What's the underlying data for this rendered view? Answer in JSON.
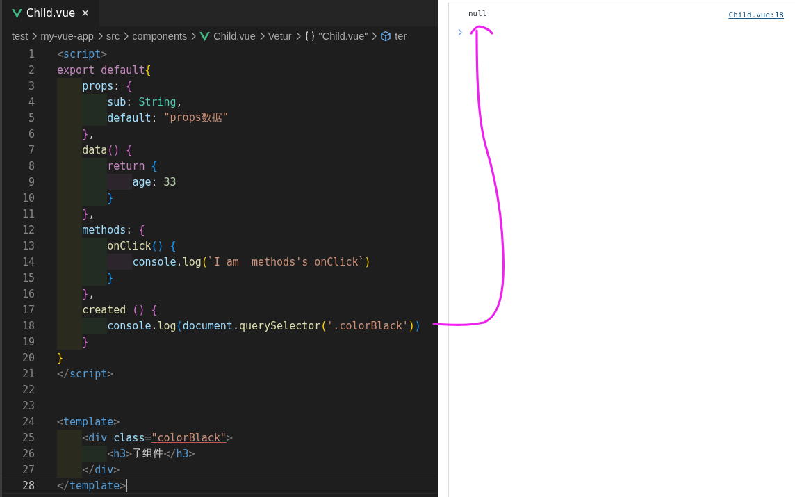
{
  "editor": {
    "tab": {
      "label": "Child.vue",
      "close": "✕",
      "selected": true
    },
    "breadcrumbs": [
      {
        "label": "test",
        "kind": "folder"
      },
      {
        "label": "my-vue-app",
        "kind": "folder"
      },
      {
        "label": "src",
        "kind": "folder"
      },
      {
        "label": "components",
        "kind": "folder"
      },
      {
        "label": "Child.vue",
        "kind": "vue"
      },
      {
        "label": "Vetur",
        "kind": "folder"
      },
      {
        "label": "\"Child.vue\"",
        "kind": "braces"
      },
      {
        "label": "ter",
        "kind": "cube"
      }
    ],
    "lines": [
      {
        "number": "1",
        "current": false,
        "tokens": [
          {
            "kind": "bracket",
            "text": "<"
          },
          {
            "kind": "tag",
            "text": "script"
          },
          {
            "kind": "bracket",
            "text": ">"
          }
        ]
      },
      {
        "number": "2",
        "current": false,
        "tokens": [
          {
            "kind": "keyword",
            "text": "export default"
          },
          {
            "kind": "brace1",
            "text": "{"
          }
        ]
      },
      {
        "number": "3",
        "current": false,
        "tokens": [
          {
            "kind": "property",
            "text": "    props"
          },
          {
            "kind": "plain",
            "text": ": "
          },
          {
            "kind": "brace2",
            "text": "{"
          }
        ]
      },
      {
        "number": "4",
        "current": false,
        "tokens": [
          {
            "kind": "property",
            "text": "        sub"
          },
          {
            "kind": "plain",
            "text": ": "
          },
          {
            "kind": "type",
            "text": "String"
          },
          {
            "kind": "plain",
            "text": ","
          }
        ]
      },
      {
        "number": "5",
        "current": false,
        "tokens": [
          {
            "kind": "property",
            "text": "        default"
          },
          {
            "kind": "plain",
            "text": ": "
          },
          {
            "kind": "string",
            "text": "\"props数据\""
          }
        ]
      },
      {
        "number": "6",
        "current": false,
        "tokens": [
          {
            "kind": "brace2",
            "text": "    }"
          },
          {
            "kind": "plain",
            "text": ","
          }
        ]
      },
      {
        "number": "7",
        "current": false,
        "tokens": [
          {
            "kind": "function",
            "text": "    data"
          },
          {
            "kind": "brace2",
            "text": "() {"
          }
        ]
      },
      {
        "number": "8",
        "current": false,
        "tokens": [
          {
            "kind": "keyword",
            "text": "        return"
          },
          {
            "kind": "brace3",
            "text": " {"
          }
        ]
      },
      {
        "number": "9",
        "current": false,
        "tokens": [
          {
            "kind": "property",
            "text": "            age"
          },
          {
            "kind": "plain",
            "text": ": "
          },
          {
            "kind": "number",
            "text": "33"
          }
        ]
      },
      {
        "number": "10",
        "current": false,
        "tokens": [
          {
            "kind": "brace3",
            "text": "        }"
          }
        ]
      },
      {
        "number": "11",
        "current": false,
        "tokens": [
          {
            "kind": "brace2",
            "text": "    }"
          },
          {
            "kind": "plain",
            "text": ","
          }
        ]
      },
      {
        "number": "12",
        "current": false,
        "tokens": [
          {
            "kind": "property",
            "text": "    methods"
          },
          {
            "kind": "plain",
            "text": ": "
          },
          {
            "kind": "brace2",
            "text": "{"
          }
        ]
      },
      {
        "number": "13",
        "current": false,
        "tokens": [
          {
            "kind": "function",
            "text": "        onClick"
          },
          {
            "kind": "brace3",
            "text": "() {"
          }
        ]
      },
      {
        "number": "14",
        "current": false,
        "tokens": [
          {
            "kind": "variable",
            "text": "            console"
          },
          {
            "kind": "plain",
            "text": "."
          },
          {
            "kind": "function",
            "text": "log"
          },
          {
            "kind": "brace1",
            "text": "("
          },
          {
            "kind": "string",
            "text": "`I am  methods's onClick`"
          },
          {
            "kind": "brace1",
            "text": ")"
          }
        ]
      },
      {
        "number": "15",
        "current": false,
        "tokens": [
          {
            "kind": "brace3",
            "text": "        }"
          }
        ]
      },
      {
        "number": "16",
        "current": false,
        "tokens": [
          {
            "kind": "brace2",
            "text": "    }"
          },
          {
            "kind": "plain",
            "text": ","
          }
        ]
      },
      {
        "number": "17",
        "current": false,
        "tokens": [
          {
            "kind": "function",
            "text": "    created"
          },
          {
            "kind": "brace2",
            "text": " () {"
          }
        ]
      },
      {
        "number": "18",
        "current": false,
        "tokens": [
          {
            "kind": "variable",
            "text": "        console"
          },
          {
            "kind": "plain",
            "text": "."
          },
          {
            "kind": "function",
            "text": "log"
          },
          {
            "kind": "brace3",
            "text": "("
          },
          {
            "kind": "variable",
            "text": "document"
          },
          {
            "kind": "plain",
            "text": "."
          },
          {
            "kind": "function",
            "text": "querySelector"
          },
          {
            "kind": "brace1",
            "text": "("
          },
          {
            "kind": "string",
            "text": "'.colorBlack'"
          },
          {
            "kind": "brace1",
            "text": ")"
          },
          {
            "kind": "brace3",
            "text": ")"
          }
        ]
      },
      {
        "number": "19",
        "current": false,
        "tokens": [
          {
            "kind": "brace2",
            "text": "    }"
          }
        ]
      },
      {
        "number": "20",
        "current": false,
        "tokens": [
          {
            "kind": "brace1",
            "text": "}"
          }
        ]
      },
      {
        "number": "21",
        "current": false,
        "tokens": [
          {
            "kind": "bracket",
            "text": "</"
          },
          {
            "kind": "tag",
            "text": "script"
          },
          {
            "kind": "bracket",
            "text": ">"
          }
        ]
      },
      {
        "number": "22",
        "current": false
      },
      {
        "number": "23",
        "current": false
      },
      {
        "number": "24",
        "current": false,
        "tokens": [
          {
            "kind": "bracket",
            "text": "<"
          },
          {
            "kind": "tag",
            "text": "template"
          },
          {
            "kind": "bracket",
            "text": ">"
          }
        ]
      },
      {
        "number": "25",
        "current": false,
        "tokens": [
          {
            "kind": "bracket",
            "text": "    <"
          },
          {
            "kind": "tag",
            "text": "div"
          },
          {
            "kind": "attr",
            "text": " class"
          },
          {
            "kind": "plain",
            "text": "="
          },
          {
            "kind": "string",
            "text": "\"colorBlack\""
          },
          {
            "kind": "bracket",
            "text": ">"
          }
        ]
      },
      {
        "number": "26",
        "current": false,
        "tokens": [
          {
            "kind": "bracket",
            "text": "        <"
          },
          {
            "kind": "tag",
            "text": "h3"
          },
          {
            "kind": "bracket",
            "text": ">"
          },
          {
            "kind": "plain",
            "text": "子组件"
          },
          {
            "kind": "bracket",
            "text": "</"
          },
          {
            "kind": "tag",
            "text": "h3"
          },
          {
            "kind": "bracket",
            "text": ">"
          }
        ]
      },
      {
        "number": "27",
        "current": false,
        "tokens": [
          {
            "kind": "bracket",
            "text": "    </"
          },
          {
            "kind": "tag",
            "text": "div"
          },
          {
            "kind": "bracket",
            "text": ">"
          }
        ]
      },
      {
        "number": "28",
        "current": true,
        "tokens": [
          {
            "kind": "bracket",
            "text": "</"
          },
          {
            "kind": "tag",
            "text": "template"
          },
          {
            "kind": "bracket",
            "text": ">"
          }
        ]
      }
    ]
  },
  "console": {
    "entries": [
      {
        "message": "null",
        "source": "Child.vue:18"
      }
    ]
  }
}
